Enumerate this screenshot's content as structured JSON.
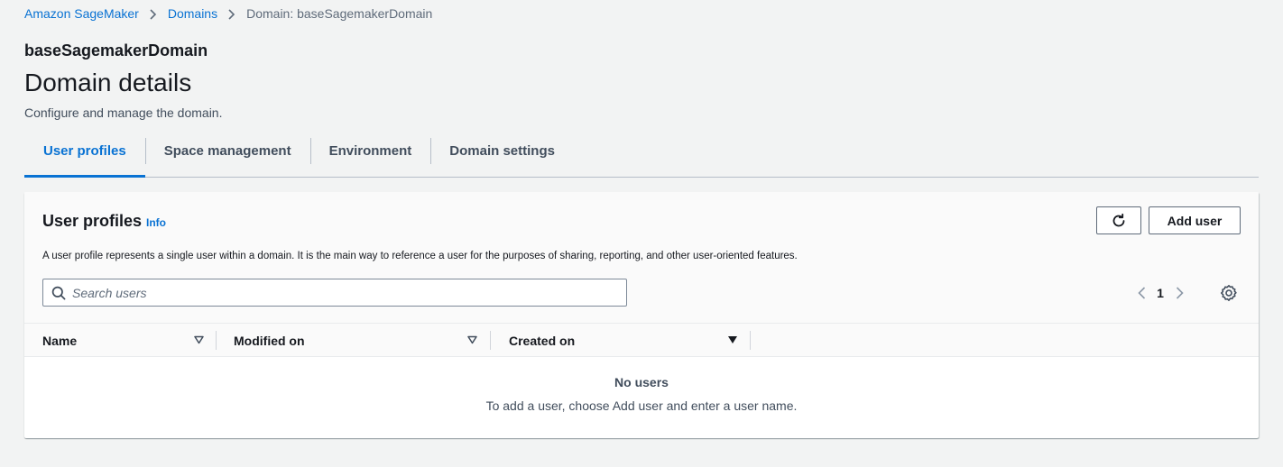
{
  "breadcrumb": {
    "items": [
      "Amazon SageMaker",
      "Domains",
      "Domain: baseSagemakerDomain"
    ]
  },
  "header": {
    "domain_name": "baseSagemakerDomain",
    "title": "Domain details",
    "description": "Configure and manage the domain."
  },
  "tabs": [
    {
      "label": "User profiles",
      "active": true
    },
    {
      "label": "Space management",
      "active": false
    },
    {
      "label": "Environment",
      "active": false
    },
    {
      "label": "Domain settings",
      "active": false
    }
  ],
  "panel": {
    "title": "User profiles",
    "info_label": "Info",
    "description": "A user profile represents a single user within a domain. It is the main way to reference a user for the purposes of sharing, reporting, and other user-oriented features.",
    "refresh_icon": "refresh-icon",
    "add_button": "Add user",
    "search": {
      "placeholder": "Search users",
      "value": ""
    },
    "pagination": {
      "current_page": "1"
    },
    "settings_icon": "gear-icon",
    "columns": [
      {
        "label": "Name",
        "sort": "sortable"
      },
      {
        "label": "Modified on",
        "sort": "sortable"
      },
      {
        "label": "Created on",
        "sort": "descending"
      }
    ],
    "empty_state": {
      "title": "No users",
      "description": "To add a user, choose Add user and enter a user name."
    }
  },
  "colors": {
    "link": "#0972d3",
    "text": "#16191f",
    "muted": "#5f6b7a",
    "background": "#f2f3f3"
  }
}
